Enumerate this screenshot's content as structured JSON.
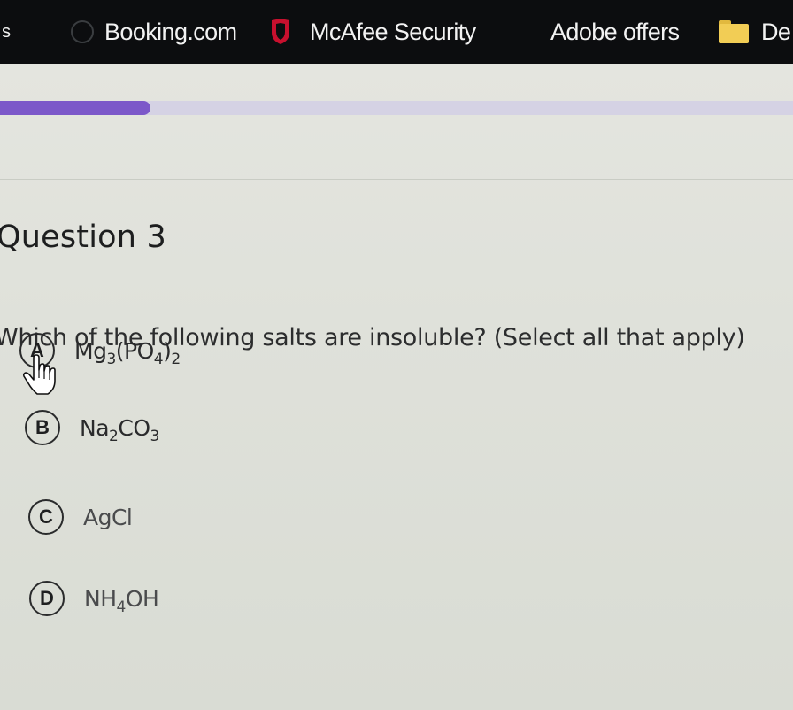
{
  "bookmarks": [
    {
      "label": "s",
      "icon": "none"
    },
    {
      "label": "Booking.com",
      "icon": "globe-icon"
    },
    {
      "label": "McAfee Security",
      "icon": "mcafee-shield-icon"
    },
    {
      "label": "Adobe offers",
      "icon": "none"
    },
    {
      "label": "De",
      "icon": "folder-icon"
    }
  ],
  "progress": {
    "fraction": 0.19
  },
  "question": {
    "title": "Question 3",
    "text": "Which of the following salts are insoluble? (Select all that apply)"
  },
  "options": [
    {
      "letter": "A",
      "formula": {
        "p1": "Mg",
        "s1": "3",
        "p2": "(PO",
        "s2": "4",
        "p3": ")",
        "s3": "2"
      }
    },
    {
      "letter": "B",
      "formula": {
        "p1": "Na",
        "s1": "2",
        "p2": "CO",
        "s2": "3"
      }
    },
    {
      "letter": "C",
      "formula": {
        "p1": "AgCl"
      }
    },
    {
      "letter": "D",
      "formula": {
        "p1": "NH",
        "s1": "4",
        "p2": "OH"
      }
    }
  ],
  "colors": {
    "accent": "#7c58c9",
    "bookmark_bar": "#0c0d0f",
    "mcafee_red": "#c8102e"
  }
}
